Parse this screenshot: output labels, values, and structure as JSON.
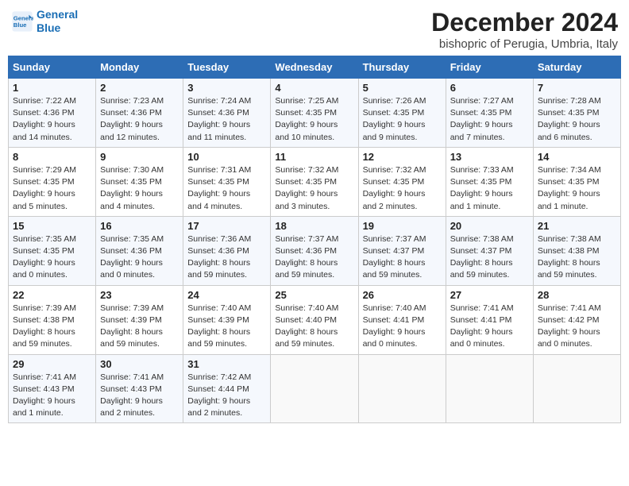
{
  "header": {
    "logo_line1": "General",
    "logo_line2": "Blue",
    "month": "December 2024",
    "subtitle": "bishopric of Perugia, Umbria, Italy"
  },
  "weekdays": [
    "Sunday",
    "Monday",
    "Tuesday",
    "Wednesday",
    "Thursday",
    "Friday",
    "Saturday"
  ],
  "weeks": [
    [
      {
        "day": "1",
        "rise": "7:22 AM",
        "set": "4:36 PM",
        "daylight": "9 hours and 14 minutes."
      },
      {
        "day": "2",
        "rise": "7:23 AM",
        "set": "4:36 PM",
        "daylight": "9 hours and 12 minutes."
      },
      {
        "day": "3",
        "rise": "7:24 AM",
        "set": "4:36 PM",
        "daylight": "9 hours and 11 minutes."
      },
      {
        "day": "4",
        "rise": "7:25 AM",
        "set": "4:35 PM",
        "daylight": "9 hours and 10 minutes."
      },
      {
        "day": "5",
        "rise": "7:26 AM",
        "set": "4:35 PM",
        "daylight": "9 hours and 9 minutes."
      },
      {
        "day": "6",
        "rise": "7:27 AM",
        "set": "4:35 PM",
        "daylight": "9 hours and 7 minutes."
      },
      {
        "day": "7",
        "rise": "7:28 AM",
        "set": "4:35 PM",
        "daylight": "9 hours and 6 minutes."
      }
    ],
    [
      {
        "day": "8",
        "rise": "7:29 AM",
        "set": "4:35 PM",
        "daylight": "9 hours and 5 minutes."
      },
      {
        "day": "9",
        "rise": "7:30 AM",
        "set": "4:35 PM",
        "daylight": "9 hours and 4 minutes."
      },
      {
        "day": "10",
        "rise": "7:31 AM",
        "set": "4:35 PM",
        "daylight": "9 hours and 4 minutes."
      },
      {
        "day": "11",
        "rise": "7:32 AM",
        "set": "4:35 PM",
        "daylight": "9 hours and 3 minutes."
      },
      {
        "day": "12",
        "rise": "7:32 AM",
        "set": "4:35 PM",
        "daylight": "9 hours and 2 minutes."
      },
      {
        "day": "13",
        "rise": "7:33 AM",
        "set": "4:35 PM",
        "daylight": "9 hours and 1 minute."
      },
      {
        "day": "14",
        "rise": "7:34 AM",
        "set": "4:35 PM",
        "daylight": "9 hours and 1 minute."
      }
    ],
    [
      {
        "day": "15",
        "rise": "7:35 AM",
        "set": "4:35 PM",
        "daylight": "9 hours and 0 minutes."
      },
      {
        "day": "16",
        "rise": "7:35 AM",
        "set": "4:36 PM",
        "daylight": "9 hours and 0 minutes."
      },
      {
        "day": "17",
        "rise": "7:36 AM",
        "set": "4:36 PM",
        "daylight": "8 hours and 59 minutes."
      },
      {
        "day": "18",
        "rise": "7:37 AM",
        "set": "4:36 PM",
        "daylight": "8 hours and 59 minutes."
      },
      {
        "day": "19",
        "rise": "7:37 AM",
        "set": "4:37 PM",
        "daylight": "8 hours and 59 minutes."
      },
      {
        "day": "20",
        "rise": "7:38 AM",
        "set": "4:37 PM",
        "daylight": "8 hours and 59 minutes."
      },
      {
        "day": "21",
        "rise": "7:38 AM",
        "set": "4:38 PM",
        "daylight": "8 hours and 59 minutes."
      }
    ],
    [
      {
        "day": "22",
        "rise": "7:39 AM",
        "set": "4:38 PM",
        "daylight": "8 hours and 59 minutes."
      },
      {
        "day": "23",
        "rise": "7:39 AM",
        "set": "4:39 PM",
        "daylight": "8 hours and 59 minutes."
      },
      {
        "day": "24",
        "rise": "7:40 AM",
        "set": "4:39 PM",
        "daylight": "8 hours and 59 minutes."
      },
      {
        "day": "25",
        "rise": "7:40 AM",
        "set": "4:40 PM",
        "daylight": "8 hours and 59 minutes."
      },
      {
        "day": "26",
        "rise": "7:40 AM",
        "set": "4:41 PM",
        "daylight": "9 hours and 0 minutes."
      },
      {
        "day": "27",
        "rise": "7:41 AM",
        "set": "4:41 PM",
        "daylight": "9 hours and 0 minutes."
      },
      {
        "day": "28",
        "rise": "7:41 AM",
        "set": "4:42 PM",
        "daylight": "9 hours and 0 minutes."
      }
    ],
    [
      {
        "day": "29",
        "rise": "7:41 AM",
        "set": "4:43 PM",
        "daylight": "9 hours and 1 minute."
      },
      {
        "day": "30",
        "rise": "7:41 AM",
        "set": "4:43 PM",
        "daylight": "9 hours and 2 minutes."
      },
      {
        "day": "31",
        "rise": "7:42 AM",
        "set": "4:44 PM",
        "daylight": "9 hours and 2 minutes."
      },
      null,
      null,
      null,
      null
    ]
  ]
}
